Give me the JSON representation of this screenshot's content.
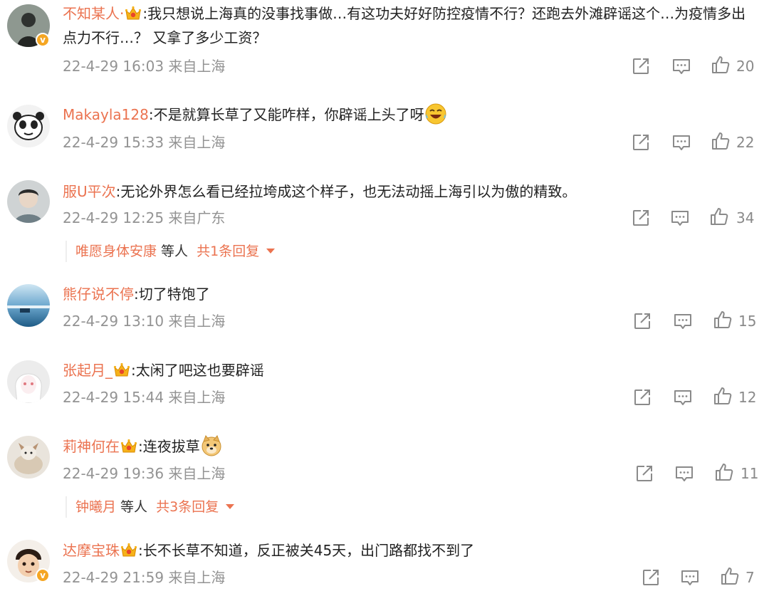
{
  "comments": [
    {
      "username": "不知某人·",
      "text": ":我只想说上海真的没事找事做…有这功夫好好防控疫情不行？还跑去外滩辟谣这个…为疫情多出点力不行…？ 又拿了多少工资？",
      "time": "22-4-29 16:03",
      "location": "来自上海",
      "likes": "20",
      "verified": "v"
    },
    {
      "username": "Makayla128",
      "text": ":不是就算长草了又能咋样，你辟谣上头了呀",
      "time": "22-4-29 15:33",
      "location": "来自上海",
      "likes": "22"
    },
    {
      "username": "服U平次",
      "text": ":无论外界怎么看已经拉垮成这个样子，也无法动摇上海引以为傲的精致。",
      "time": "22-4-29 12:25",
      "location": "来自广东",
      "likes": "34",
      "replies": {
        "name": "唯愿身体安康",
        "others": " 等人 ",
        "total": "共1条回复"
      }
    },
    {
      "username": "熊仔说不停",
      "text": ":切了特饱了",
      "time": "22-4-29 13:10",
      "location": "来自上海",
      "likes": "15"
    },
    {
      "username": "张起月_",
      "text": ":太闲了吧这也要辟谣",
      "time": "22-4-29 15:44",
      "location": "来自上海",
      "likes": "12"
    },
    {
      "username": "莉神何在",
      "text": ":连夜拔草",
      "time": "22-4-29 19:36",
      "location": "来自上海",
      "likes": "11",
      "replies": {
        "name": "钟曦月",
        "others": " 等人 ",
        "total": "共3条回复"
      }
    },
    {
      "username": "达摩宝珠",
      "text": ":长不长草不知道，反正被关45天，出门路都找不到了",
      "time": "22-4-29 21:59",
      "location": "来自上海",
      "likes": "7",
      "verified": "v"
    }
  ],
  "icons": {
    "share": "share-icon",
    "comment": "comment-icon",
    "like": "thumbs-up-icon",
    "crown": "crown-badge-icon",
    "verified": "verified-badge-icon"
  },
  "colors": {
    "username": "#eb7350",
    "meta": "#939393",
    "icon": "#8a8a8a",
    "badge": "#f5a623"
  }
}
